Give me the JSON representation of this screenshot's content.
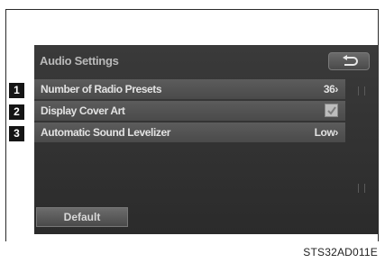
{
  "screen": {
    "title": "Audio Settings",
    "rows": [
      {
        "badge": "1",
        "label": "Number of Radio Presets",
        "value": "36›"
      },
      {
        "badge": "2",
        "label": "Display Cover Art",
        "checked": true
      },
      {
        "badge": "3",
        "label": "Automatic Sound Levelizer",
        "value": "Low›"
      }
    ],
    "default_label": "Default"
  },
  "caption": "STS32AD011E",
  "icons": {
    "back": "back-arrow-icon",
    "check": "check-icon"
  }
}
